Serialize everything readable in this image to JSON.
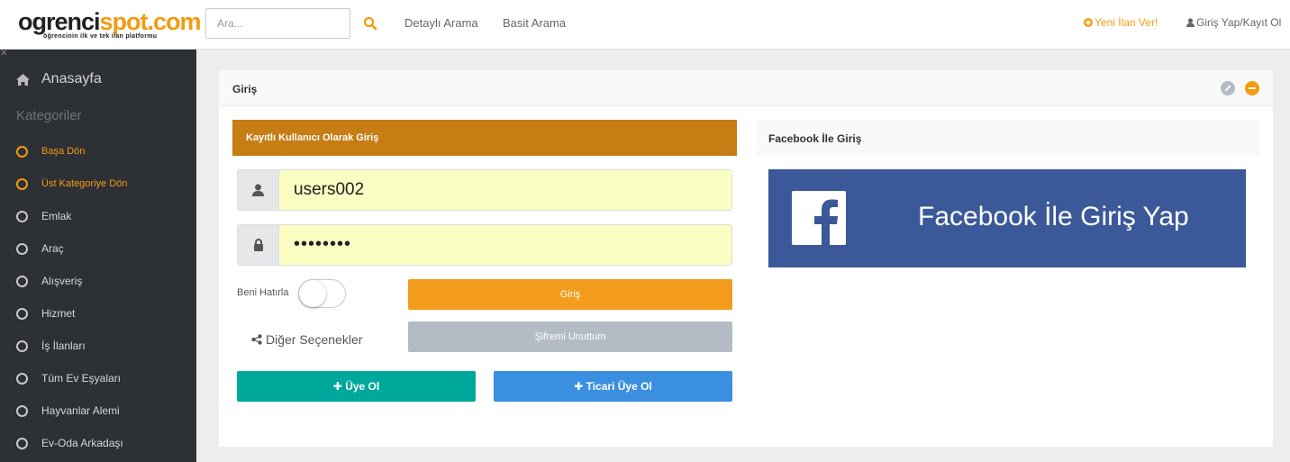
{
  "header": {
    "logo_part1": "ogrenci",
    "logo_part2": "spot.com",
    "logo_tagline": "öğrencinin ilk ve tek ilan platformu",
    "search_placeholder": "Ara...",
    "nav_detayli": "Detaylı Arama",
    "nav_basit": "Basit Arama",
    "yeni_ilan": "Yeni İlan Ver!",
    "giris_kayit": "Giriş Yap/Kayıt Ol"
  },
  "sidebar": {
    "home": "Anasayfa",
    "categories_title": "Kategoriler",
    "items": [
      {
        "label": "Başa Dön",
        "active": true
      },
      {
        "label": "Üst Kategoriye Dön",
        "active": true
      },
      {
        "label": "Emlak",
        "active": false
      },
      {
        "label": "Araç",
        "active": false
      },
      {
        "label": "Alışveriş",
        "active": false
      },
      {
        "label": "Hizmet",
        "active": false
      },
      {
        "label": "İş İlanları",
        "active": false
      },
      {
        "label": "Tüm Ev Eşyaları",
        "active": false
      },
      {
        "label": "Hayvanlar Alemi",
        "active": false
      },
      {
        "label": "Ev-Oda Arkadaşı",
        "active": false
      }
    ]
  },
  "panel": {
    "title": "Giriş",
    "login_header": "Kayıtlı Kullanıcı Olarak Giriş",
    "username_value": "users002",
    "password_value": "••••••••",
    "remember_label": "Beni Hatırla",
    "login_button": "Giriş",
    "other_options": "Diğer Seçenekler",
    "forgot_button": "Şifremi Unuttum",
    "register_button": "Üye Ol",
    "business_register_button": "Ticari Üye Ol",
    "facebook_header": "Facebook İle Giriş",
    "facebook_button": "Facebook İle Giriş Yap"
  },
  "colors": {
    "accent_orange": "#f39c12",
    "login_header_bg": "#c57d14",
    "register_teal": "#00a89c",
    "business_blue": "#3b8fdf",
    "facebook_blue": "#3b5998",
    "sidebar_bg": "#2d3035"
  }
}
